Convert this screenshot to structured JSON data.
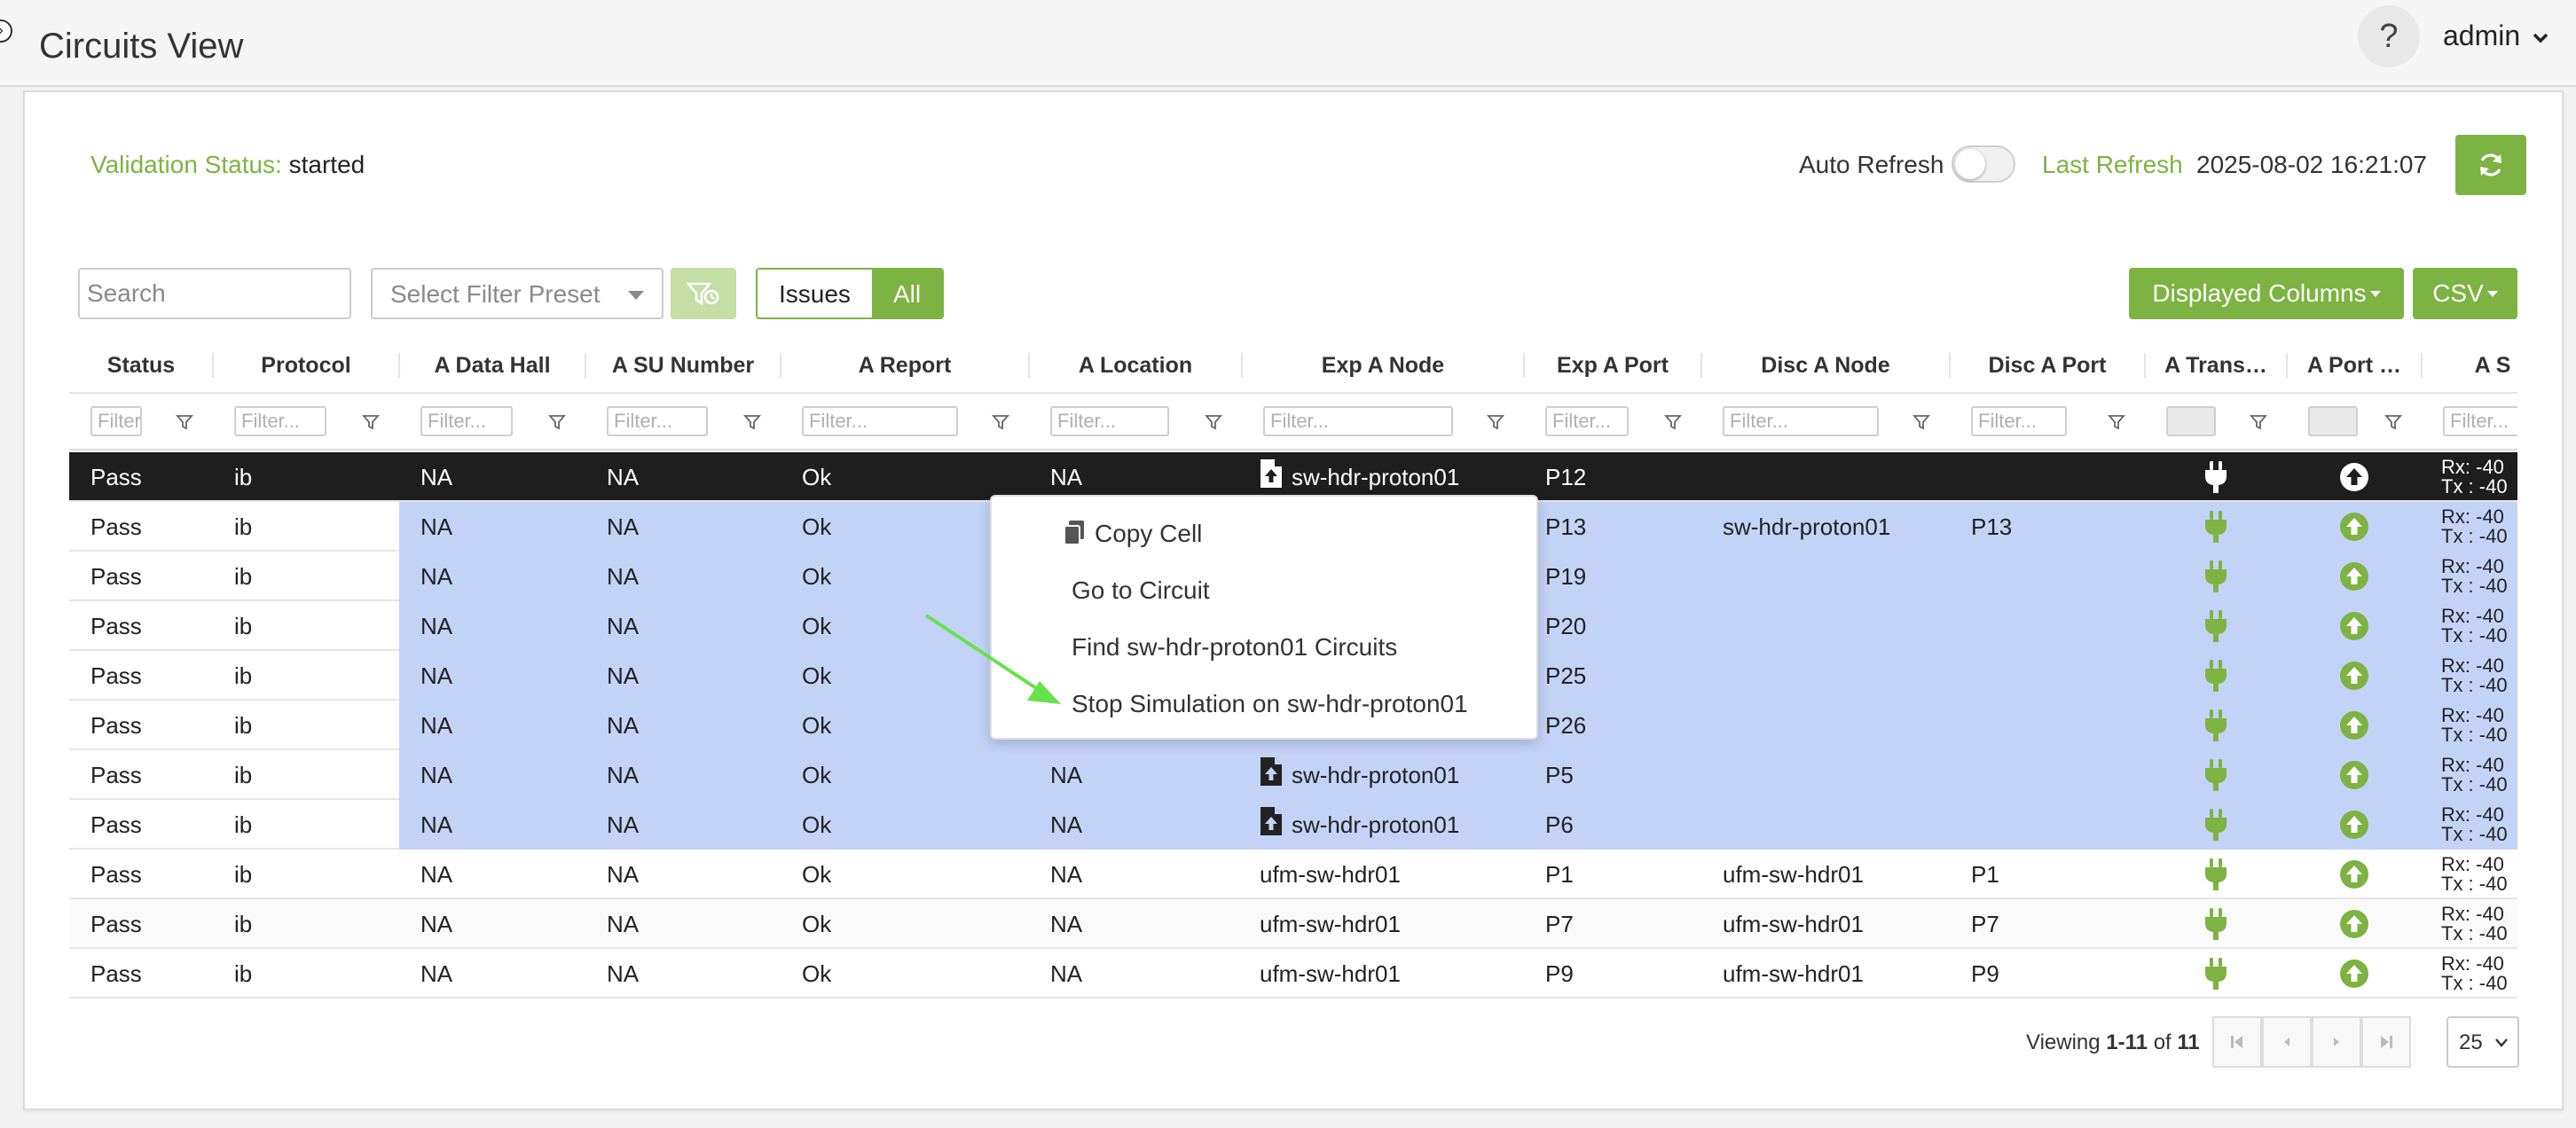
{
  "header": {
    "nav_toggle_glyph": "›",
    "title": "Circuits View",
    "help_glyph": "?",
    "user": "admin"
  },
  "status": {
    "validation_label": "Validation Status:",
    "validation_value": "started",
    "auto_refresh_label": "Auto Refresh",
    "auto_refresh_on": false,
    "last_refresh_label": "Last Refresh",
    "last_refresh_value": "2025-08-02 16:21:07"
  },
  "toolbar": {
    "search_placeholder": "Search",
    "filter_preset_placeholder": "Select Filter Preset",
    "issues_label": "Issues",
    "all_label": "All",
    "displayed_columns_label": "Displayed Columns",
    "csv_label": "CSV"
  },
  "columns": [
    "Status",
    "Protocol",
    "A Data Hall",
    "A SU Number",
    "A Report",
    "A Location",
    "Exp A Node",
    "Exp A Port",
    "Disc A Node",
    "Disc A Port",
    "A Trans…",
    "A Port …",
    "A S"
  ],
  "filter_placeholder": "Filter...",
  "rows": [
    {
      "status": "Pass",
      "protocol": "ib",
      "data_hall": "NA",
      "su": "NA",
      "report": "Ok",
      "location": "NA",
      "exp_node": "sw-hdr-proton01",
      "exp_port": "P12",
      "disc_node": "",
      "disc_port": "",
      "rx": "Rx: -40",
      "tx": "Tx : -40"
    },
    {
      "status": "Pass",
      "protocol": "ib",
      "data_hall": "NA",
      "su": "NA",
      "report": "Ok",
      "location": "",
      "exp_node": "",
      "exp_port": "P13",
      "disc_node": "sw-hdr-proton01",
      "disc_port": "P13",
      "rx": "Rx: -40",
      "tx": "Tx : -40"
    },
    {
      "status": "Pass",
      "protocol": "ib",
      "data_hall": "NA",
      "su": "NA",
      "report": "Ok",
      "location": "",
      "exp_node": "",
      "exp_port": "P19",
      "disc_node": "",
      "disc_port": "",
      "rx": "Rx: -40",
      "tx": "Tx : -40"
    },
    {
      "status": "Pass",
      "protocol": "ib",
      "data_hall": "NA",
      "su": "NA",
      "report": "Ok",
      "location": "",
      "exp_node": "",
      "exp_port": "P20",
      "disc_node": "",
      "disc_port": "",
      "rx": "Rx: -40",
      "tx": "Tx : -40"
    },
    {
      "status": "Pass",
      "protocol": "ib",
      "data_hall": "NA",
      "su": "NA",
      "report": "Ok",
      "location": "",
      "exp_node": "",
      "exp_port": "P25",
      "disc_node": "",
      "disc_port": "",
      "rx": "Rx: -40",
      "tx": "Tx : -40"
    },
    {
      "status": "Pass",
      "protocol": "ib",
      "data_hall": "NA",
      "su": "NA",
      "report": "Ok",
      "location": "",
      "exp_node": "",
      "exp_port": "P26",
      "disc_node": "",
      "disc_port": "",
      "rx": "Rx: -40",
      "tx": "Tx : -40"
    },
    {
      "status": "Pass",
      "protocol": "ib",
      "data_hall": "NA",
      "su": "NA",
      "report": "Ok",
      "location": "NA",
      "exp_node": "sw-hdr-proton01",
      "exp_port": "P5",
      "disc_node": "",
      "disc_port": "",
      "rx": "Rx: -40",
      "tx": "Tx : -40"
    },
    {
      "status": "Pass",
      "protocol": "ib",
      "data_hall": "NA",
      "su": "NA",
      "report": "Ok",
      "location": "NA",
      "exp_node": "sw-hdr-proton01",
      "exp_port": "P6",
      "disc_node": "",
      "disc_port": "",
      "rx": "Rx: -40",
      "tx": "Tx : -40"
    },
    {
      "status": "Pass",
      "protocol": "ib",
      "data_hall": "NA",
      "su": "NA",
      "report": "Ok",
      "location": "NA",
      "exp_node": "ufm-sw-hdr01",
      "exp_port": "P1",
      "disc_node": "ufm-sw-hdr01",
      "disc_port": "P1",
      "rx": "Rx: -40",
      "tx": "Tx : -40"
    },
    {
      "status": "Pass",
      "protocol": "ib",
      "data_hall": "NA",
      "su": "NA",
      "report": "Ok",
      "location": "NA",
      "exp_node": "ufm-sw-hdr01",
      "exp_port": "P7",
      "disc_node": "ufm-sw-hdr01",
      "disc_port": "P7",
      "rx": "Rx: -40",
      "tx": "Tx : -40"
    },
    {
      "status": "Pass",
      "protocol": "ib",
      "data_hall": "NA",
      "su": "NA",
      "report": "Ok",
      "location": "NA",
      "exp_node": "ufm-sw-hdr01",
      "exp_port": "P9",
      "disc_node": "ufm-sw-hdr01",
      "disc_port": "P9",
      "rx": "Rx: -40",
      "tx": "Tx : -40"
    }
  ],
  "row_states": {
    "active_row": 0,
    "selected_rows": [
      1,
      2,
      3,
      4,
      5,
      6,
      7
    ],
    "file_icon_rows": [
      0,
      6,
      7
    ]
  },
  "pager": {
    "viewing_prefix": "Viewing",
    "range": "1-11",
    "of_label": "of",
    "total": "11",
    "page_size": "25"
  },
  "context_menu": {
    "items": [
      "Copy Cell",
      "Go to Circuit",
      "Find sw-hdr-proton01 Circuits",
      "Stop Simulation on sw-hdr-proton01"
    ]
  },
  "colors": {
    "accent": "#7cb342",
    "selected_row": "#c3d2f7",
    "active_row": "#1e1e1e",
    "annotation_arrow": "#66e34a"
  },
  "icons": {
    "trans": "plug-icon",
    "port": "arrow-up-circle-icon",
    "exp_node": "file-upload-icon"
  }
}
